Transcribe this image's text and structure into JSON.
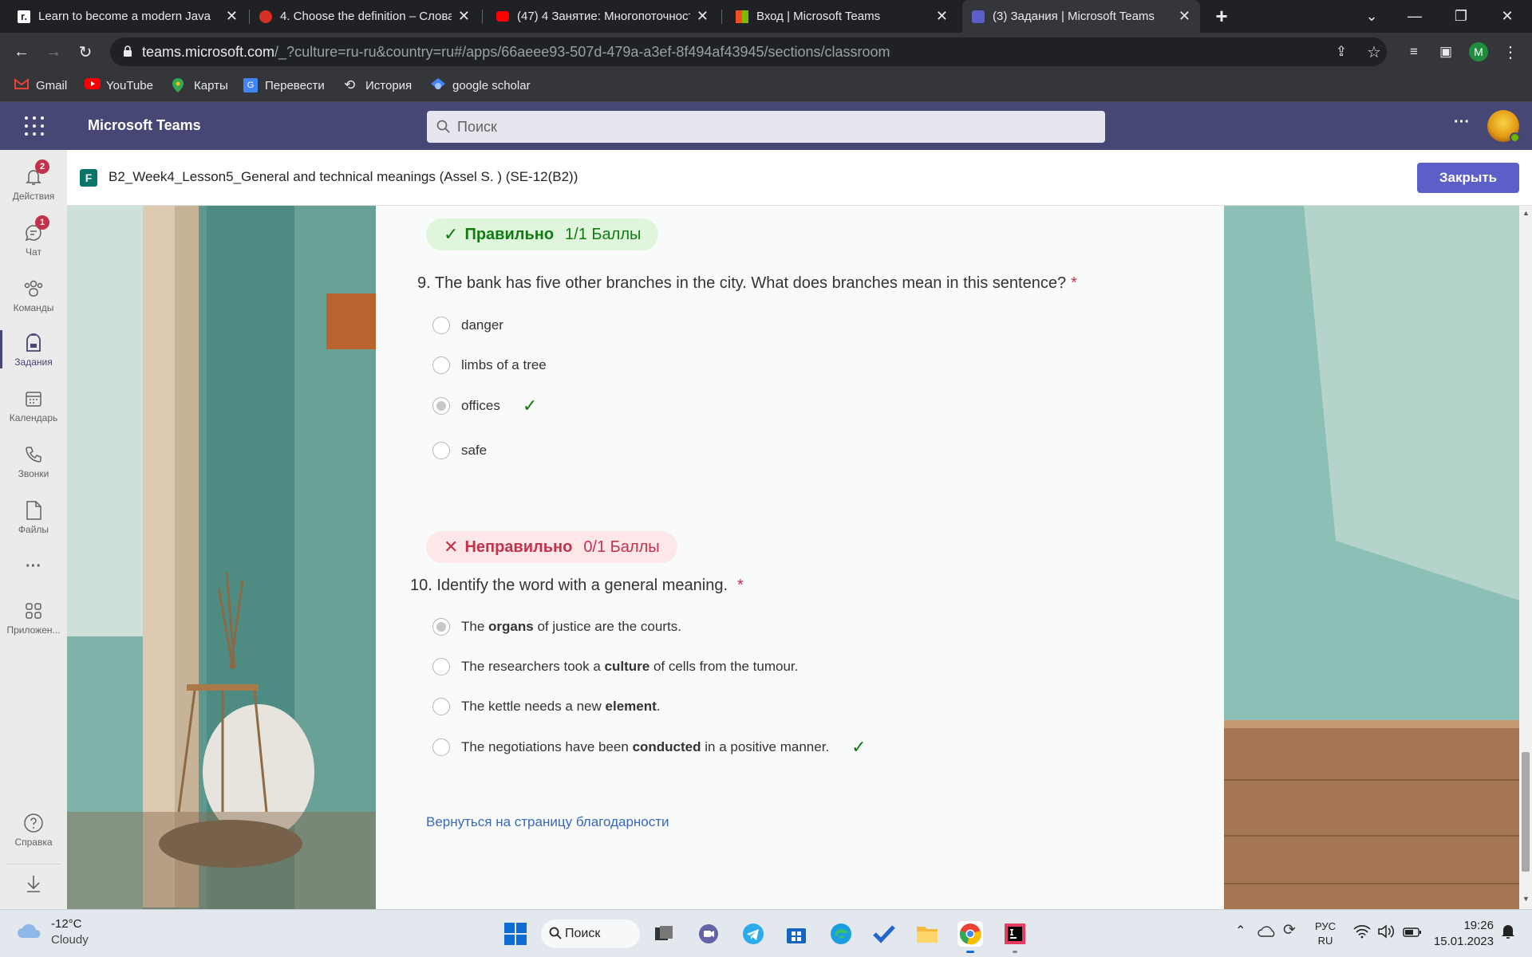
{
  "browser": {
    "tabs": [
      {
        "title": "Learn to become a modern Java",
        "close": "✕"
      },
      {
        "title": "4. Choose the definition – Слова",
        "close": "✕"
      },
      {
        "title": "(47) 4 Занятие: Многопоточност",
        "close": "✕"
      },
      {
        "title": "Вход | Microsoft Teams",
        "close": "✕"
      },
      {
        "title": "(3) Задания | Microsoft Teams",
        "close": "✕"
      }
    ],
    "new_tab": "+",
    "url_host": "teams.microsoft.com",
    "url_rest": "/_?culture=ru-ru&country=ru#/apps/66aeee93-507d-479a-a3ef-8f494af43945/sections/classroom",
    "profile_initial": "M",
    "bookmarks": [
      {
        "label": "Gmail",
        "icon": "gmail-icon",
        "color": "#ea4335"
      },
      {
        "label": "YouTube",
        "icon": "youtube-icon",
        "color": "#ff0000"
      },
      {
        "label": "Карты",
        "icon": "maps-icon",
        "color": "#34a853"
      },
      {
        "label": "Перевести",
        "icon": "translate-icon",
        "color": "#4285f4"
      },
      {
        "label": "История",
        "icon": "history-icon",
        "color": "#e8eaed"
      },
      {
        "label": "google scholar",
        "icon": "scholar-icon",
        "color": "#4285f4"
      }
    ]
  },
  "teams": {
    "app_name": "Microsoft Teams",
    "search_placeholder": "Поиск",
    "more": "···",
    "rail": [
      {
        "label": "Действия",
        "icon": "bell-icon",
        "badge": "2"
      },
      {
        "label": "Чат",
        "icon": "chat-icon",
        "badge": "1"
      },
      {
        "label": "Команды",
        "icon": "teams-icon",
        "badge": ""
      },
      {
        "label": "Задания",
        "icon": "assignments-icon",
        "badge": ""
      },
      {
        "label": "Календарь",
        "icon": "calendar-icon",
        "badge": ""
      },
      {
        "label": "Звонки",
        "icon": "phone-icon",
        "badge": ""
      },
      {
        "label": "Файлы",
        "icon": "file-icon",
        "badge": ""
      },
      {
        "label": "",
        "icon": "more-icon",
        "badge": ""
      },
      {
        "label": "Приложен...",
        "icon": "apps-icon",
        "badge": ""
      }
    ],
    "help_label": "Справка",
    "header_title": "B2_Week4_Lesson5_General and technical meanings  (Assel S. ) (SE-12(B2))",
    "close_button": "Закрыть"
  },
  "quiz": {
    "q9": {
      "status": "Правильно",
      "score": "1/1 Баллы",
      "number": "9.",
      "text": "The bank has five other branches in the city.  What does branches mean in this sentence?",
      "required": "*",
      "options": [
        {
          "text": "danger",
          "selected": false,
          "correct": false
        },
        {
          "text": "limbs of a tree",
          "selected": false,
          "correct": false
        },
        {
          "text": "offices",
          "selected": true,
          "correct": true
        },
        {
          "text": "safe",
          "selected": false,
          "correct": false
        }
      ]
    },
    "q10": {
      "status": "Неправильно",
      "score": "0/1 Баллы",
      "number": "10.",
      "text": "Identify the word with a general meaning.",
      "required": "*",
      "options": [
        {
          "pre": "The ",
          "bold": "organs",
          "post": " of justice are the courts.",
          "selected": true,
          "correct": false
        },
        {
          "pre": "The researchers took a ",
          "bold": "culture",
          "post": " of cells from the tumour.",
          "selected": false,
          "correct": false
        },
        {
          "pre": "The kettle needs a new ",
          "bold": "element",
          "post": ".",
          "selected": false,
          "correct": false
        },
        {
          "pre": "The negotiations have been ",
          "bold": "conducted",
          "post": " in a positive manner.",
          "selected": false,
          "correct": true
        }
      ]
    },
    "back_link": "Вернуться на страницу благодарности"
  },
  "taskbar": {
    "weather_temp": "-12°C",
    "weather_desc": "Cloudy",
    "search_label": "Поиск",
    "lang_top": "РУС",
    "lang_bottom": "RU",
    "time": "19:26",
    "date": "15.01.2023"
  },
  "colors": {
    "teams_purple": "#464775",
    "correct_green": "#107c10",
    "correct_bg": "#dff6dd",
    "incorrect_red": "#c4314b",
    "incorrect_bg": "#fde7e9",
    "link_blue": "#3a68b8"
  }
}
